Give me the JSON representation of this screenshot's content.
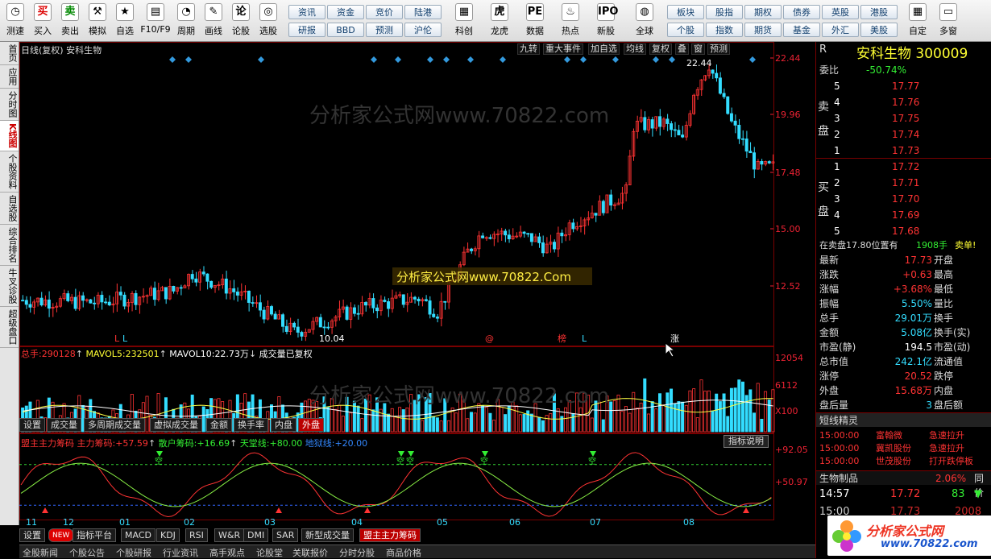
{
  "toolbar": {
    "buttons": [
      {
        "label": "测速",
        "icon": "clock-icon",
        "sym": "◷"
      },
      {
        "label": "买入",
        "icon": "buy-icon",
        "sym": "买"
      },
      {
        "label": "卖出",
        "icon": "sell-icon",
        "sym": "卖"
      },
      {
        "label": "模拟",
        "icon": "hammer-icon",
        "sym": "⚒"
      },
      {
        "label": "自选",
        "icon": "star-icon",
        "sym": "★"
      },
      {
        "label": "F10/F9",
        "icon": "f10-icon",
        "sym": "▤"
      },
      {
        "label": "周期",
        "icon": "period-icon",
        "sym": "◔"
      },
      {
        "label": "画线",
        "icon": "pen-icon",
        "sym": "✎"
      },
      {
        "label": "论股",
        "icon": "discuss-icon",
        "sym": "论"
      },
      {
        "label": "选股",
        "icon": "select-stock-icon",
        "sym": "◎"
      }
    ],
    "grid": [
      {
        "top": "资讯",
        "bottom": "研报"
      },
      {
        "top": "资金",
        "bottom": "BBD"
      },
      {
        "top": "竞价",
        "bottom": "预测"
      },
      {
        "top": "陆港",
        "bottom": "沪伦"
      }
    ],
    "buttons2": [
      {
        "label": "科创",
        "icon": "chart-icon",
        "sym": "▦"
      },
      {
        "label": "龙虎",
        "icon": "tiger-icon",
        "sym": "虎"
      },
      {
        "label": "数据",
        "icon": "pe-icon",
        "sym": "PE"
      },
      {
        "label": "热点",
        "icon": "hot-icon",
        "sym": "♨"
      },
      {
        "label": "新股",
        "icon": "ipo-icon",
        "sym": "IPO"
      },
      {
        "label": "全球",
        "icon": "globe-icon",
        "sym": "◍"
      }
    ],
    "grid2": [
      {
        "top": "板块",
        "bottom": "个股"
      },
      {
        "top": "股指",
        "bottom": "指数"
      },
      {
        "top": "期权",
        "bottom": "期货"
      },
      {
        "top": "债券",
        "bottom": "基金"
      },
      {
        "top": "英股",
        "bottom": "外汇"
      },
      {
        "top": "港股",
        "bottom": "美股"
      }
    ],
    "buttons3": [
      {
        "label": "自定",
        "icon": "custom-icon",
        "sym": "▦"
      },
      {
        "label": "多窗",
        "icon": "window-icon",
        "sym": "▭"
      }
    ]
  },
  "lefttabs": [
    "首页",
    "应用",
    "分时图",
    "K线图",
    "个股资料",
    "自选股",
    "综合排名",
    "牛叉诊股",
    "超级盘口"
  ],
  "lefttab_active": "K线图",
  "kline": {
    "title": "日线(复权) 安科生物",
    "buttons": [
      "九转",
      "重大事件",
      "加自选",
      "均线",
      "复权",
      "叠",
      "窗",
      "预测"
    ],
    "axis": [
      "22.44",
      "19.96",
      "17.48",
      "15.00",
      "12.52"
    ],
    "high_label": "22.44",
    "low_label": "10.04",
    "watermark": "分析家公式网www.70822.com",
    "overlay_text": "分析家公式网www.70822.Com",
    "markers": [
      "L",
      "L",
      "@",
      "榜",
      "L",
      "涨"
    ]
  },
  "volume": {
    "title_prefix": "总手:",
    "total": "290128",
    "mavol5_label": "MAVOL5:",
    "mavol5": "232501",
    "mavol10_label": "MAVOL10:",
    "mavol10": "22.73万",
    "note": "成交量已复权",
    "axis": [
      "12054",
      "6112",
      "X100"
    ],
    "tabs": [
      "设置",
      "成交量",
      "多周期成交量",
      "虚拟成交量",
      "金额",
      "换手率",
      "内盘",
      "外盘"
    ],
    "active_tab": "外盘"
  },
  "indicator": {
    "name": "盟主主力筹码",
    "main_label": "主力筹码:",
    "main": "+57.59",
    "retail_label": "散户筹码:",
    "retail": "+16.69",
    "heaven_label": "天堂线:",
    "heaven": "+80.00",
    "hell_label": "地狱线:",
    "hell": "+20.00",
    "help": "指标说明",
    "axis": [
      "+92.05",
      "+50.97"
    ],
    "markers": [
      "空",
      "空",
      "空",
      "空",
      "空"
    ]
  },
  "xaxis": [
    "11",
    "12",
    "01",
    "02",
    "03",
    "04",
    "05",
    "06",
    "07",
    "08"
  ],
  "indicator_tabs": [
    "设置",
    "NEW",
    "指标平台",
    "MACD",
    "KDJ",
    "RSI",
    "W&R",
    "DMI",
    "SAR",
    "新型成交量",
    "盟主主力筹码"
  ],
  "bottom_tabs": [
    "全股新闻",
    "个股公告",
    "个股研报",
    "行业资讯",
    "高手观点",
    "论股堂",
    "关联报价",
    "分时分股",
    "商品价格"
  ],
  "quote": {
    "title": "安科生物",
    "code": "300009",
    "r": "R",
    "weibi_label": "委比",
    "weibi": "-50.74%",
    "sell_label": "卖盘",
    "buy_label": "买盘",
    "sells": [
      {
        "n": "5",
        "p": "17.77"
      },
      {
        "n": "4",
        "p": "17.76"
      },
      {
        "n": "3",
        "p": "17.75"
      },
      {
        "n": "2",
        "p": "17.74"
      },
      {
        "n": "1",
        "p": "17.73"
      }
    ],
    "buys": [
      {
        "n": "1",
        "p": "17.72"
      },
      {
        "n": "2",
        "p": "17.71"
      },
      {
        "n": "3",
        "p": "17.70"
      },
      {
        "n": "4",
        "p": "17.69"
      },
      {
        "n": "5",
        "p": "17.68"
      }
    ],
    "notice_a": "在卖盘17.80位置有",
    "notice_b": "1908手",
    "notice_c": "卖单!",
    "stats": [
      {
        "l": "最新",
        "v": "17.73",
        "c": "red",
        "r": "开盘"
      },
      {
        "l": "涨跌",
        "v": "+0.63",
        "c": "red",
        "r": "最高"
      },
      {
        "l": "涨幅",
        "v": "+3.68%",
        "c": "red",
        "r": "最低"
      },
      {
        "l": "振幅",
        "v": "5.50%",
        "c": "cyan",
        "r": "量比"
      },
      {
        "l": "总手",
        "v": "29.01万",
        "c": "cyan",
        "r": "换手"
      },
      {
        "l": "金额",
        "v": "5.08亿",
        "c": "cyan",
        "r": "换手(实)"
      },
      {
        "l": "市盈(静)",
        "v": "194.5",
        "c": "white",
        "r": "市盈(动)"
      },
      {
        "l": "总市值",
        "v": "242.1亿",
        "c": "cyan",
        "r": "流通值"
      },
      {
        "l": "涨停",
        "v": "20.52",
        "c": "red",
        "r": "跌停"
      },
      {
        "l": "外盘",
        "v": "15.68万",
        "c": "red",
        "r": "内盘"
      },
      {
        "l": "盘后量",
        "v": "3",
        "c": "cyan",
        "r": "盘后额"
      }
    ],
    "sprite_title": "短线精灵",
    "sprites": [
      {
        "t": "15:00:00",
        "n": "富翰微",
        "a": "急速拉升"
      },
      {
        "t": "15:00:00",
        "n": "冀凯股份",
        "a": "急速拉升"
      },
      {
        "t": "15:00:00",
        "n": "世茂股份",
        "a": "打开跌停板"
      }
    ],
    "sector": "生物制品",
    "sector_pct": "2.06%",
    "sector_extra": "同价",
    "tick": {
      "t": "14:57",
      "p": "17.72",
      "v": "83"
    },
    "tick2": {
      "t": "15:00",
      "p": "17.73",
      "v": "2008"
    },
    "logo": "分析家公式网",
    "logo_url": "www.70822.com"
  },
  "colors": {
    "up": "#ff3333",
    "down": "#33ddff",
    "bg": "#000000",
    "frame": "#7a0000"
  }
}
